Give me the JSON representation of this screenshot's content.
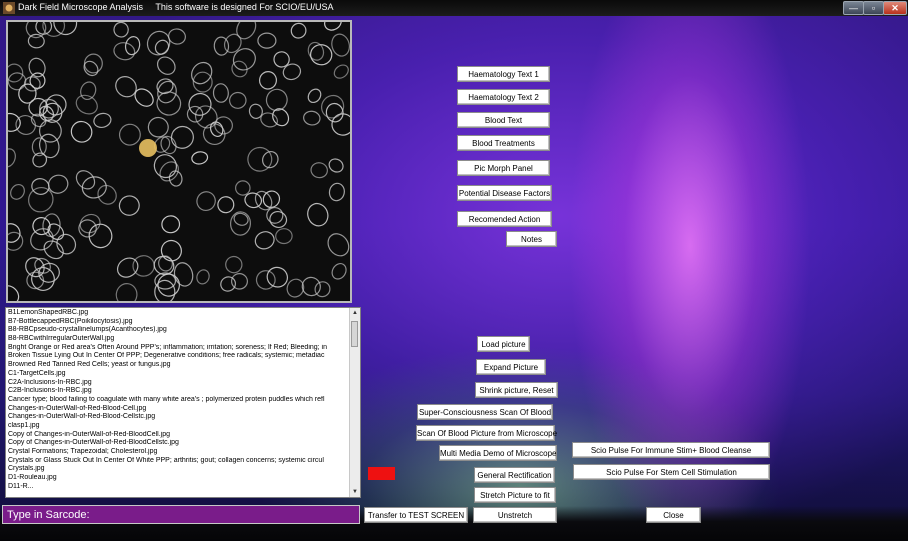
{
  "window": {
    "title": "Dark Field Microscope Analysis     This software is designed For SCIO/EU/USA",
    "controls": {
      "minimize": "—",
      "maximize": "▫",
      "close": "✕"
    }
  },
  "side_buttons": [
    "Haematology Text 1",
    "Haematology Text 2",
    "Blood Text",
    "Blood Treatments",
    "Pic Morph Panel",
    "Potential Disease Factors",
    "Recomended Action",
    "Notes"
  ],
  "picture_buttons": {
    "load": "Load picture",
    "expand": "Expand Picture",
    "shrink": "Shrink picture, Reset",
    "super_scan": "Super-Consciousness Scan Of Blood",
    "scan_micro": "Scan Of Blood Picture from Microscope",
    "multimedia": "Multi Media Demo of Microscope",
    "general_rect": "General Rectification",
    "stretch": "Stretch Picture to fit",
    "unstretch": "Unstretch",
    "transfer": "Transfer to TEST SCREEN"
  },
  "scio_buttons": {
    "immune": "Scio Pulse For Immune Stim+ Blood Cleanse",
    "stem": "Scio Pulse For Stem Cell Stimulation"
  },
  "close_button": "Close",
  "sarcode_input": {
    "placeholder": "Type in Sarcode:",
    "value": ""
  },
  "file_list": [
    "B1LemonShapedRBC.jpg",
    "B7-BottlecappedRBC(Poikilocytosis).jpg",
    "B8-RBCpseudo-crystallinelumps(Acanthocytes).jpg",
    "B8-RBCwithIrregularOuterWall.jpg",
    "Bright Orange or Red area's Often Around PPP's; inflammation; irritation; soreness; If Red; Bleeding; in",
    "Broken Tissue Lying Out In Center Of PPP; Degenerative conditions; free radicals; systemic; metadiac",
    "Browned Red Tanned Red Cells; yeast or fungus.jpg",
    "C1-TargetCells.jpg",
    "C2A-Inclusions-In-RBC.jpg",
    "C2B-Inclusions-In-RBC.jpg",
    "Cancer type; blood failing to coagulate with many white area's ; polymerized protein puddles which refl",
    "Changes-in-OuterWall-of-Red-Blood-Cell.jpg",
    "Changes-in-OuterWall-of-Red-Blood-Cellstc.jpg",
    "clasp1.jpg",
    "Copy of Changes-in-OuterWall-of-Red-BloodCell.jpg",
    "Copy of Changes-in-OuterWall-of-Red-BloodCellstc.jpg",
    "Crystal Formations; Trapezoidal; Cholesterol.jpg",
    "Crystals or Glass Stuck Out In Center Of White PPP; arthritis; gout; collagen concerns; systemic circul",
    "Crystals.jpg",
    "D1-Rouleau.jpg",
    "D11-R..."
  ],
  "colors": {
    "sarcode_bar": "#7a1c8a",
    "indicator": "#ee1111",
    "sky_top": "#3d1a9a",
    "aurora_pink": "#ff82ff",
    "aurora_green": "#8cdc8c"
  }
}
